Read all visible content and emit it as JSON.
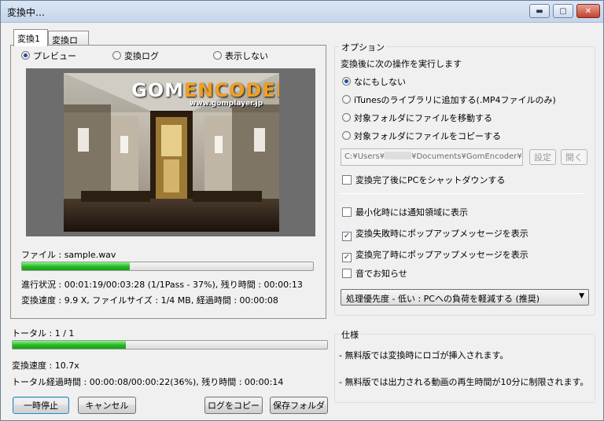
{
  "window": {
    "title": "変換中…",
    "controls": {
      "minimize": "▬",
      "maximize": "▢",
      "close": "✕"
    }
  },
  "tabs": [
    {
      "label": "変換1",
      "active": true
    },
    {
      "label": "変換ログ",
      "active": false
    }
  ],
  "view_modes": [
    {
      "label": "プレビュー",
      "selected": true
    },
    {
      "label": "変換ログ",
      "selected": false
    },
    {
      "label": "表示しない",
      "selected": false
    }
  ],
  "preview": {
    "logo_brand": "GOM",
    "logo_word": "ENCODER",
    "logo_site": "www.gomplayer.jp"
  },
  "file_status": {
    "file": "ファイル : sample.wav",
    "progress": 0.37,
    "progress_text": "進行状況 : 00:01:19/00:03:28 (1/1Pass - 37%), 残り時間 : 00:00:13",
    "speed_text": "変換速度 : 9.9 X, ファイルサイズ : 1/4 MB, 経過時間 : 00:00:08"
  },
  "total_status": {
    "label": "トータル : 1 / 1",
    "progress": 0.36,
    "speed_text": "変換速度 : 10.7x",
    "elapsed_text": "トータル経過時間 : 00:00:08/00:00:22(36%), 残り時間 : 00:00:14"
  },
  "buttons": {
    "pause": "一時停止",
    "cancel": "キャンセル",
    "copy_log": "ログをコピー",
    "save_folder": "保存フォルダ",
    "settings": "設定",
    "open": "開く"
  },
  "options": {
    "group_title": "オプション",
    "after_label": "変換後に次の操作を実行します",
    "after_actions": [
      {
        "label": "なにもしない",
        "selected": true
      },
      {
        "label": "iTunesのライブラリに追加する(.MP4ファイルのみ)",
        "selected": false
      },
      {
        "label": "対象フォルダにファイルを移動する",
        "selected": false
      },
      {
        "label": "対象フォルダにファイルをコピーする",
        "selected": false
      }
    ],
    "path_prefix": "C:¥Users¥",
    "path_suffix": "¥Documents¥GomEncoder¥",
    "shutdown": {
      "label": "変換完了後にPCをシャットダウンする",
      "checked": false
    },
    "checks": [
      {
        "label": "最小化時には通知領域に表示",
        "checked": false
      },
      {
        "label": "変換失敗時にポップアップメッセージを表示",
        "checked": true
      },
      {
        "label": "変換完了時にポップアップメッセージを表示",
        "checked": true
      },
      {
        "label": "音でお知らせ",
        "checked": false
      }
    ],
    "priority": "処理優先度 - 低い : PCへの負荷を軽減する (推奨)"
  },
  "spec": {
    "group_title": "仕様",
    "lines": [
      "- 無料版では変換時にロゴが挿入されます。",
      "- 無料版では出力される動画の再生時間が10分に制限されます。"
    ]
  },
  "colors": {
    "progress_fill": "#22b822",
    "title_bar": "#c3d5ea",
    "close_button": "#c4412c"
  }
}
